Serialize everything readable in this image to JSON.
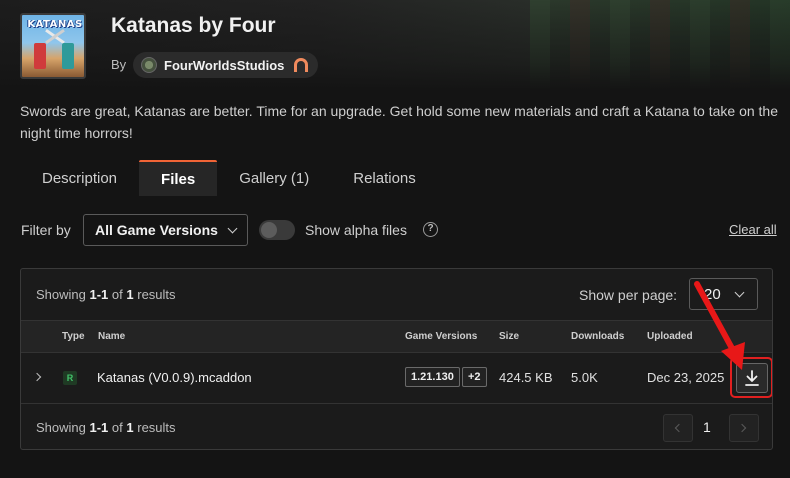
{
  "project": {
    "title": "Katanas by Four",
    "logo_text": "KATANAS",
    "by_label": "By",
    "author": "FourWorldsStudios",
    "summary": "Swords are great, Katanas are better. Time for an upgrade. Get hold some new materials and craft a Katana to take on the night time horrors!"
  },
  "tabs": [
    {
      "label": "Description",
      "active": false
    },
    {
      "label": "Files",
      "active": true
    },
    {
      "label": "Gallery (1)",
      "active": false
    },
    {
      "label": "Relations",
      "active": false
    }
  ],
  "filters": {
    "label": "Filter by",
    "version_select": "All Game Versions",
    "alpha_toggle_label": "Show alpha files",
    "alpha_toggle_on": false,
    "help_symbol": "?",
    "clear_all": "Clear all"
  },
  "results": {
    "prefix": "Showing",
    "range": "1-1",
    "of": "of",
    "total": "1",
    "suffix": "results",
    "per_page_label": "Show per page:",
    "per_page_value": "20"
  },
  "table": {
    "headers": {
      "type": "Type",
      "name": "Name",
      "versions": "Game Versions",
      "size": "Size",
      "downloads": "Downloads",
      "uploaded": "Uploaded"
    },
    "rows": [
      {
        "type_badge": "R",
        "name": "Katanas (V0.0.9).mcaddon",
        "version": "1.21.130",
        "extra_versions": "+2",
        "size": "424.5 KB",
        "downloads": "5.0K",
        "uploaded": "Dec 23, 2025"
      }
    ]
  },
  "pagination": {
    "current_page": "1"
  },
  "colors": {
    "accent": "#f16436",
    "highlight": "#e02020",
    "release_badge": "#42c26a"
  }
}
